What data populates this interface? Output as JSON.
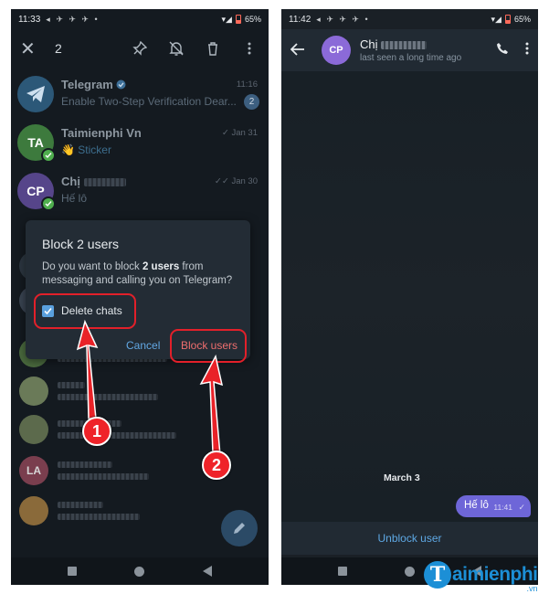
{
  "left": {
    "status": {
      "time": "11:33",
      "icons": "◂ ✈ ✈ ✈ •",
      "battery": "65%"
    },
    "selection": {
      "count": "2"
    },
    "chats": [
      {
        "name": "Telegram",
        "message": "Enable Two-Step Verification Dear...",
        "time": "11:16",
        "badge": "2",
        "avatar": "",
        "color": "#2c5878"
      },
      {
        "name": "Taimienphi Vn",
        "message": "👋 Sticker",
        "time": "Jan 31",
        "avatar": "TA",
        "color": "#3d7a3d"
      },
      {
        "name": "Chị",
        "message": "Hế lô",
        "time": "Jan 30",
        "avatar": "CP",
        "color": "#56458a"
      }
    ],
    "dialog": {
      "title": "Block 2 users",
      "text_pre": "Do you want to block ",
      "text_bold": "2 users",
      "text_post": " from messaging and calling you on Telegram?",
      "checkbox_label": "Delete chats",
      "cancel": "Cancel",
      "confirm": "Block users"
    },
    "dim_avatars": [
      "LA"
    ],
    "annotations": [
      "1",
      "2"
    ]
  },
  "right": {
    "status": {
      "time": "11:42",
      "icons": "◂ ✈ ✈ ✈ •",
      "battery": "65%"
    },
    "contact": {
      "avatar": "CP",
      "name": "Chị",
      "last_seen": "last seen a long time ago"
    },
    "date_label": "March 3",
    "message": {
      "text": "Hế lô",
      "time": "11:41"
    },
    "unblock": "Unblock user"
  },
  "watermark": {
    "letter": "T",
    "text": "aimienphi",
    "suffix": ".vn"
  },
  "colors": {
    "accent_blue": "#5ea8e4",
    "danger_red": "#ee6e6e",
    "annotation_red": "#e2202a",
    "bubble": "#6e66d8"
  }
}
